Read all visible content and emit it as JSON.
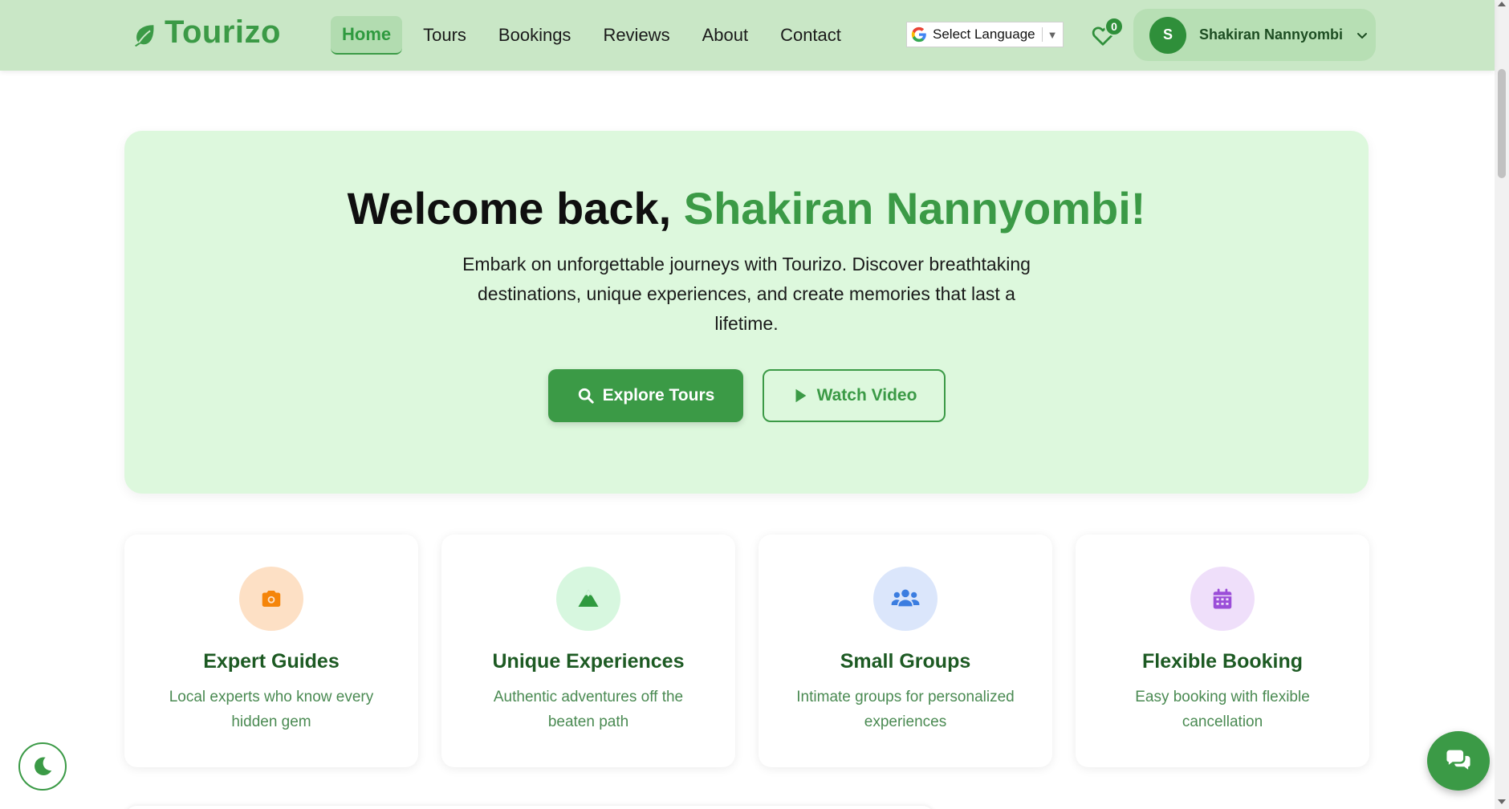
{
  "brand": {
    "name": "Tourizo",
    "icon": "leaf-icon",
    "color": "#3b9a46"
  },
  "nav": {
    "items": [
      {
        "label": "Home",
        "active": true
      },
      {
        "label": "Tours",
        "active": false
      },
      {
        "label": "Bookings",
        "active": false
      },
      {
        "label": "Reviews",
        "active": false
      },
      {
        "label": "About",
        "active": false
      },
      {
        "label": "Contact",
        "active": false
      }
    ]
  },
  "language": {
    "label": "Select Language",
    "arrow": "▼",
    "icon": "google-icon"
  },
  "favorites": {
    "icon": "heart-icon",
    "count": "0"
  },
  "user": {
    "initial": "S",
    "name": "Shakiran Nannyombi",
    "icon": "chevron-down-icon"
  },
  "hero": {
    "greeting": "Welcome back, ",
    "name": "Shakiran Nannyombi!",
    "description": "Embark on unforgettable journeys with Tourizo. Discover breathtaking destinations, unique experiences, and create memories that last a lifetime.",
    "primary_button": "Explore Tours",
    "secondary_button": "Watch Video"
  },
  "features": [
    {
      "title": "Expert Guides",
      "description": "Local experts who know every hidden gem",
      "icon": "camera-icon",
      "icon_color": "#f5850a",
      "bg_color": "#fde0c5"
    },
    {
      "title": "Unique Experiences",
      "description": "Authentic adventures off the beaten path",
      "icon": "mountain-icon",
      "icon_color": "#2f9a3f",
      "bg_color": "#d7f7df"
    },
    {
      "title": "Small Groups",
      "description": "Intimate groups for personalized experiences",
      "icon": "users-icon",
      "icon_color": "#3b7de0",
      "bg_color": "#dbe6fb"
    },
    {
      "title": "Flexible Booking",
      "description": "Easy booking with flexible cancellation",
      "icon": "calendar-icon",
      "icon_color": "#9b4ed8",
      "bg_color": "#efdffa"
    }
  ],
  "floating": {
    "theme_toggle_icon": "moon-icon",
    "chat_icon": "chat-icon"
  }
}
